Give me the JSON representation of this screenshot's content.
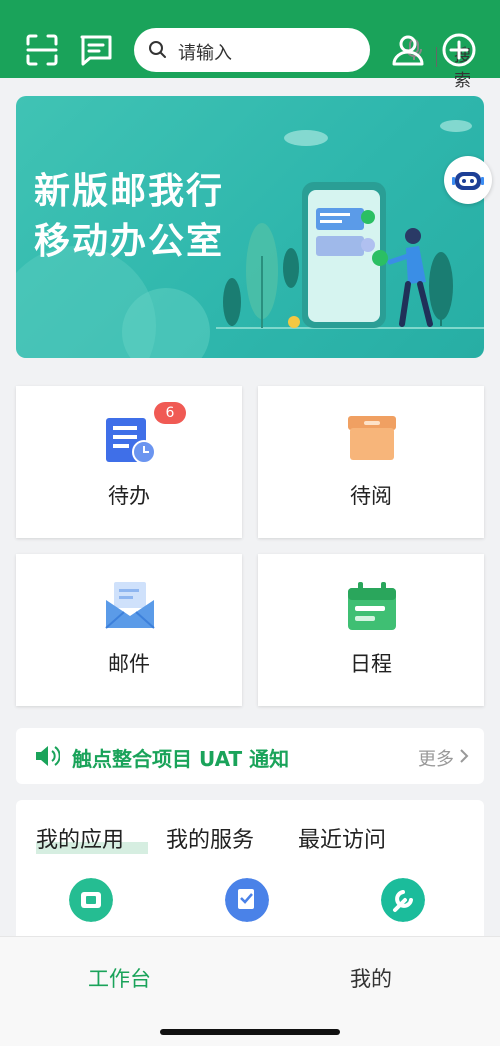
{
  "header": {
    "scan_icon": "scan-icon",
    "message_icon": "message-icon",
    "search": {
      "placeholder": "请输入",
      "button_label": "搜索",
      "mic_icon": "mic-icon"
    },
    "user_icon": "user-icon",
    "add_icon": "add-circle-icon"
  },
  "banner": {
    "line1": "新版邮我行",
    "line2": "移动办公室",
    "assistant_icon": "robot-icon"
  },
  "quick_cards": [
    {
      "label": "待办",
      "icon": "todo-icon",
      "badge": "6"
    },
    {
      "label": "待阅",
      "icon": "to-read-icon"
    },
    {
      "label": "邮件",
      "icon": "mail-icon"
    },
    {
      "label": "日程",
      "icon": "calendar-icon"
    }
  ],
  "notice": {
    "text": "触点整合项目 UAT 通知",
    "more": "更多",
    "icon": "speaker-icon"
  },
  "apps": {
    "tabs": [
      "我的应用",
      "我的服务",
      "最近访问"
    ],
    "active_tab": 0
  },
  "tabbar": {
    "items": [
      "工作台",
      "我的"
    ],
    "active": 0
  },
  "colors": {
    "primary": "#1aa35a",
    "banner": "#2fb7ad",
    "badge": "#f05a54"
  }
}
